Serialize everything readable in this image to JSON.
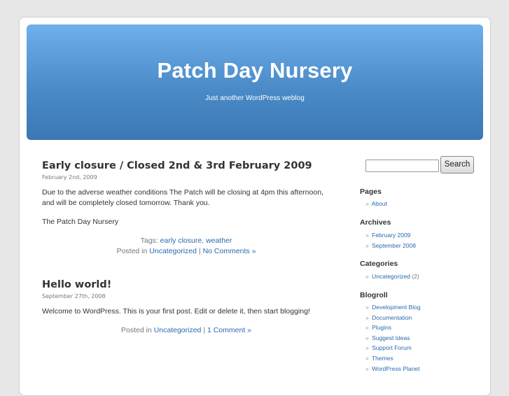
{
  "header": {
    "title": "Patch Day Nursery",
    "description": "Just another WordPress weblog"
  },
  "posts": [
    {
      "title": "Early closure / Closed 2nd & 3rd February 2009",
      "date": "February 2nd, 2009",
      "paragraphs": [
        "Due to the adverse weather conditions The Patch will be closing at 4pm this afternoon, and will be completely closed tomorrow. Thank you.",
        "The Patch Day Nursery"
      ],
      "tags_label": "Tags: ",
      "tags": [
        "early closure",
        "weather"
      ],
      "tag_separator": ", ",
      "posted_in_label": "Posted in ",
      "category": "Uncategorized",
      "separator": " | ",
      "comments": "No Comments »"
    },
    {
      "title": "Hello world!",
      "date": "September 27th, 2008",
      "paragraphs": [
        "Welcome to WordPress. This is your first post. Edit or delete it, then start blogging!"
      ],
      "posted_in_label": "Posted in ",
      "category": "Uncategorized",
      "separator": " | ",
      "comments": "1 Comment »"
    }
  ],
  "sidebar": {
    "search": {
      "value": "",
      "button_label": "Search"
    },
    "bullet": "»",
    "pages": {
      "title": "Pages",
      "items": [
        "About"
      ]
    },
    "archives": {
      "title": "Archives",
      "items": [
        "February 2009",
        "September 2008"
      ]
    },
    "categories": {
      "title": "Categories",
      "items": [
        {
          "label": "Uncategorized",
          "count": "(2)"
        }
      ]
    },
    "blogroll": {
      "title": "Blogroll",
      "items": [
        "Development Blog",
        "Documentation",
        "Plugins",
        "Suggest Ideas",
        "Support Forum",
        "Themes",
        "WordPress Planet"
      ]
    }
  },
  "colors": {
    "header_top": "#6fb0ec",
    "header_bottom": "#3b78b4",
    "link": "#2a6ab0",
    "page_background": "#e7e7e7"
  }
}
